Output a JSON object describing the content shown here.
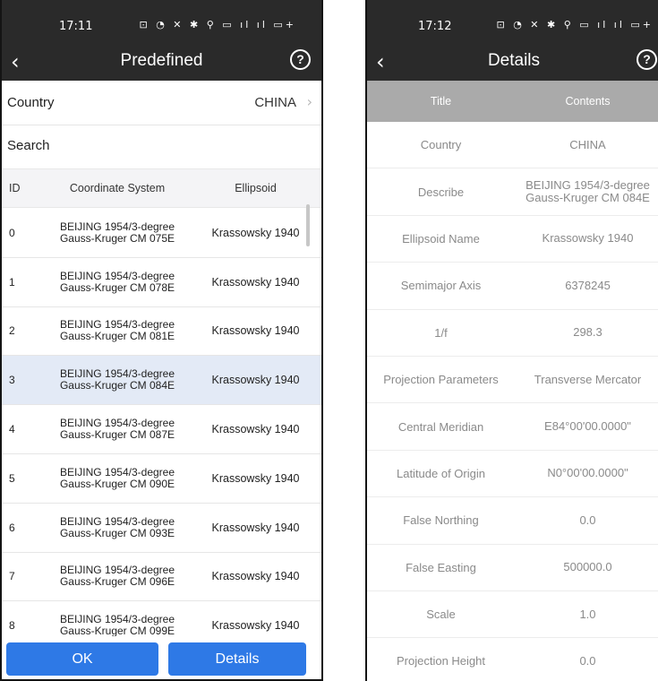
{
  "left": {
    "status": {
      "time": "17:11",
      "icons": "NFC bell vibrate location HD signal signal battery"
    },
    "titlebar": {
      "back": "‹",
      "title": "Predefined",
      "help": "?"
    },
    "country": {
      "label": "Country",
      "value": "CHINA",
      "chevron": "›"
    },
    "search": {
      "label": "Search"
    },
    "table": {
      "headers": {
        "id": "ID",
        "cs": "Coordinate System",
        "el": "Ellipsoid"
      },
      "rows": [
        {
          "id": "0",
          "cs1": "BEIJING 1954/3-degree",
          "cs2": "Gauss-Kruger CM 075E",
          "el": "Krassowsky 1940"
        },
        {
          "id": "1",
          "cs1": "BEIJING 1954/3-degree",
          "cs2": "Gauss-Kruger CM 078E",
          "el": "Krassowsky 1940"
        },
        {
          "id": "2",
          "cs1": "BEIJING 1954/3-degree",
          "cs2": "Gauss-Kruger CM 081E",
          "el": "Krassowsky 1940"
        },
        {
          "id": "3",
          "cs1": "BEIJING 1954/3-degree",
          "cs2": "Gauss-Kruger CM 084E",
          "el": "Krassowsky 1940"
        },
        {
          "id": "4",
          "cs1": "BEIJING 1954/3-degree",
          "cs2": "Gauss-Kruger CM 087E",
          "el": "Krassowsky 1940"
        },
        {
          "id": "5",
          "cs1": "BEIJING 1954/3-degree",
          "cs2": "Gauss-Kruger CM 090E",
          "el": "Krassowsky 1940"
        },
        {
          "id": "6",
          "cs1": "BEIJING 1954/3-degree",
          "cs2": "Gauss-Kruger CM 093E",
          "el": "Krassowsky 1940"
        },
        {
          "id": "7",
          "cs1": "BEIJING 1954/3-degree",
          "cs2": "Gauss-Kruger CM 096E",
          "el": "Krassowsky 1940"
        },
        {
          "id": "8",
          "cs1": "BEIJING 1954/3-degree",
          "cs2": "Gauss-Kruger CM 099E",
          "el": "Krassowsky 1940"
        }
      ],
      "selected_index": 3
    },
    "buttons": {
      "ok": "OK",
      "details": "Details"
    },
    "colors": {
      "bar": "#2a2a2a",
      "accent": "#2e79e6",
      "selected_row": "#e3eaf6"
    }
  },
  "right": {
    "status": {
      "time": "17:12",
      "icons": "NFC bell vibrate location HD signal signal battery"
    },
    "titlebar": {
      "back": "‹",
      "title": "Details",
      "help": "?"
    },
    "header": {
      "title": "Title",
      "contents": "Contents"
    },
    "rows": [
      {
        "title": "Country",
        "value": "CHINA"
      },
      {
        "title": "Describe",
        "value": "BEIJING 1954/3-degree",
        "value2": "Gauss-Kruger CM 084E"
      },
      {
        "title": "Ellipsoid Name",
        "value": "Krassowsky 1940"
      },
      {
        "title": "Semimajor Axis",
        "value": "6378245"
      },
      {
        "title": "1/f",
        "value": "298.3"
      },
      {
        "title": "Projection Parameters",
        "value": "Transverse Mercator"
      },
      {
        "title": "Central Meridian",
        "value": "E84°00'00.0000\""
      },
      {
        "title": "Latitude of Origin",
        "value": "N0°00'00.0000\""
      },
      {
        "title": "False Northing",
        "value": "0.0"
      },
      {
        "title": "False Easting",
        "value": "500000.0"
      },
      {
        "title": "Scale",
        "value": "1.0"
      },
      {
        "title": "Projection Height",
        "value": "0.0"
      }
    ],
    "colors": {
      "header_bg": "#aaaaaa"
    }
  }
}
